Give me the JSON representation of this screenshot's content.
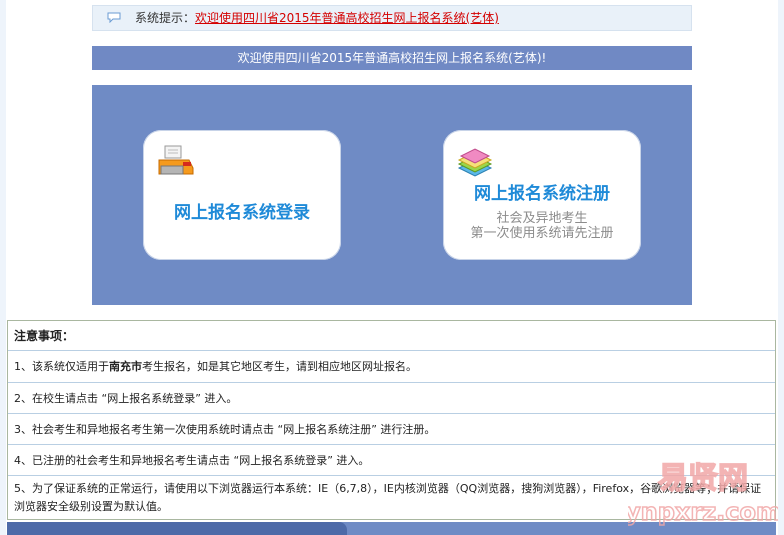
{
  "notice": {
    "label": "系统提示：",
    "message": "欢迎使用四川省2015年普通高校招生网上报名系统(艺体)"
  },
  "welcome": "欢迎使用四川省2015年普通高校招生网上报名系统(艺体)!",
  "cards": {
    "login": {
      "title": "网上报名系统登录"
    },
    "register": {
      "title": "网上报名系统注册",
      "sub1": "社会及异地考生",
      "sub2": "第一次使用系统请先注册"
    }
  },
  "notes": {
    "heading": "注意事项：",
    "item1_pre": "1、该系统仅适用于",
    "item1_city": "南充市",
    "item1_post": "考生报名，如是其它地区考生，请到相应地区网址报名。",
    "item2": "2、在校生请点击 “网上报名系统登录” 进入。",
    "item3": "3、社会考生和异地报名考生第一次使用系统时请点击 “网上报名系统注册” 进行注册。",
    "item4": "4、已注册的社会考生和异地报名考生请点击 “网上报名系统登录” 进入。",
    "item5": "5、为了保证系统的正常运行，请使用以下浏览器运行本系统：IE（6,7,8），IE内核浏览器（QQ浏览器，搜狗浏览器），Firefox，谷歌浏览器等；并请保证浏览器安全级别设置为默认值。"
  },
  "watermark": {
    "line1": "易贤网",
    "line2": "ynpxrz.com"
  },
  "colors": {
    "panel": "#6f8bc5",
    "card_title": "#1f8ad8",
    "notice_link": "#d40000"
  }
}
